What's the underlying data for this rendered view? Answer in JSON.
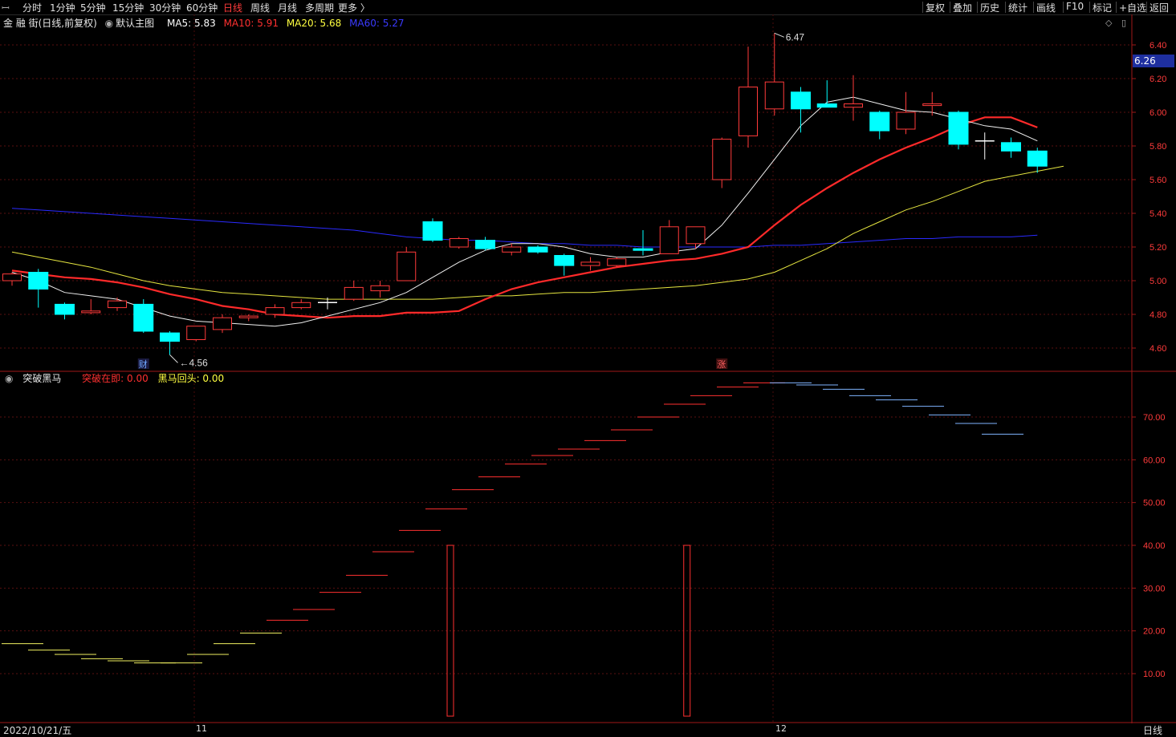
{
  "toolbar": {
    "left_icon": "ꟷ",
    "tabs": [
      {
        "label": "分时",
        "active": false
      },
      {
        "label": "1分钟",
        "active": false
      },
      {
        "label": "5分钟",
        "active": false
      },
      {
        "label": "15分钟",
        "active": false
      },
      {
        "label": "30分钟",
        "active": false
      },
      {
        "label": "60分钟",
        "active": false
      },
      {
        "label": "日线",
        "active": true
      },
      {
        "label": "周线",
        "active": false
      },
      {
        "label": "月线",
        "active": false
      },
      {
        "label": "多周期",
        "active": false
      },
      {
        "label": "更多 〉",
        "active": false
      }
    ],
    "right_buttons": [
      "复权",
      "叠加",
      "历史",
      "统计",
      "画线",
      "F10",
      "标记",
      "+自选",
      "返回"
    ]
  },
  "info": {
    "stock": "金 融 街(日线,前复权)",
    "main_chart": "默认主图",
    "ma5": "MA5: 5.83",
    "ma10": "MA10: 5.91",
    "ma20": "MA20: 5.68",
    "ma60": "MA60: 5.27",
    "ma5_color": "#ffffff",
    "ma10_color": "#ff3030",
    "ma20_color": "#ffff40",
    "ma60_color": "#3030ff"
  },
  "indicator": {
    "name": "突破黑马",
    "breakout": "突破在即: 0.00",
    "pullback": "黑马回头: 0.00"
  },
  "price_axis": [
    "6.40",
    "6.20",
    "6.00",
    "5.80",
    "5.60",
    "5.40",
    "5.20",
    "5.00",
    "4.80",
    "4.60"
  ],
  "current_price": "6.26",
  "high_label": "6.47",
  "low_label": "4.56",
  "markers": {
    "cai": "财",
    "zhang": "涨"
  },
  "sub_axis": [
    "70.00",
    "60.00",
    "50.00",
    "40.00",
    "30.00",
    "20.00",
    "10.00"
  ],
  "bottom": {
    "date": "2022/10/21/五",
    "m11": "11",
    "m12": "12",
    "period": "日线"
  },
  "chart_data": [
    {
      "type": "candlestick",
      "title": "金融街(日线,前复权)",
      "ylim": [
        4.5,
        6.5
      ],
      "candles": [
        {
          "o": 5.0,
          "h": 5.05,
          "l": 4.97,
          "c": 5.04
        },
        {
          "o": 5.05,
          "h": 5.07,
          "l": 4.84,
          "c": 4.95
        },
        {
          "o": 4.86,
          "h": 4.87,
          "l": 4.77,
          "c": 4.8
        },
        {
          "o": 4.81,
          "h": 4.89,
          "l": 4.8,
          "c": 4.82
        },
        {
          "o": 4.84,
          "h": 4.9,
          "l": 4.82,
          "c": 4.88
        },
        {
          "o": 4.86,
          "h": 4.89,
          "l": 4.69,
          "c": 4.7
        },
        {
          "o": 4.69,
          "h": 4.7,
          "l": 4.56,
          "c": 4.64
        },
        {
          "o": 4.65,
          "h": 4.73,
          "l": 4.64,
          "c": 4.73
        },
        {
          "o": 4.71,
          "h": 4.8,
          "l": 4.69,
          "c": 4.78
        },
        {
          "o": 4.78,
          "h": 4.8,
          "l": 4.76,
          "c": 4.79
        },
        {
          "o": 4.8,
          "h": 4.86,
          "l": 4.78,
          "c": 4.84
        },
        {
          "o": 4.84,
          "h": 4.89,
          "l": 4.83,
          "c": 4.87
        },
        {
          "o": 4.87,
          "h": 4.9,
          "l": 4.83,
          "c": 4.87
        },
        {
          "o": 4.89,
          "h": 5.0,
          "l": 4.88,
          "c": 4.96
        },
        {
          "o": 4.94,
          "h": 5.0,
          "l": 4.9,
          "c": 4.97
        },
        {
          "o": 5.0,
          "h": 5.2,
          "l": 5.0,
          "c": 5.17
        },
        {
          "o": 5.35,
          "h": 5.37,
          "l": 5.23,
          "c": 5.24
        },
        {
          "o": 5.2,
          "h": 5.26,
          "l": 5.19,
          "c": 5.25
        },
        {
          "o": 5.24,
          "h": 5.26,
          "l": 5.18,
          "c": 5.19
        },
        {
          "o": 5.17,
          "h": 5.22,
          "l": 5.15,
          "c": 5.2
        },
        {
          "o": 5.2,
          "h": 5.21,
          "l": 5.16,
          "c": 5.17
        },
        {
          "o": 5.15,
          "h": 5.16,
          "l": 5.03,
          "c": 5.09
        },
        {
          "o": 5.09,
          "h": 5.14,
          "l": 5.06,
          "c": 5.11
        },
        {
          "o": 5.09,
          "h": 5.14,
          "l": 5.08,
          "c": 5.13
        },
        {
          "o": 5.19,
          "h": 5.3,
          "l": 5.15,
          "c": 5.18
        },
        {
          "o": 5.16,
          "h": 5.36,
          "l": 5.16,
          "c": 5.32
        },
        {
          "o": 5.22,
          "h": 5.32,
          "l": 5.19,
          "c": 5.32
        },
        {
          "o": 5.6,
          "h": 5.85,
          "l": 5.55,
          "c": 5.84
        },
        {
          "o": 5.86,
          "h": 6.39,
          "l": 5.79,
          "c": 6.15
        },
        {
          "o": 6.02,
          "h": 6.47,
          "l": 5.98,
          "c": 6.18
        },
        {
          "o": 6.12,
          "h": 6.15,
          "l": 5.88,
          "c": 6.02
        },
        {
          "o": 6.05,
          "h": 6.19,
          "l": 6.03,
          "c": 6.03
        },
        {
          "o": 6.03,
          "h": 6.22,
          "l": 5.95,
          "c": 6.05
        },
        {
          "o": 6.0,
          "h": 6.01,
          "l": 5.84,
          "c": 5.89
        },
        {
          "o": 5.9,
          "h": 6.12,
          "l": 5.87,
          "c": 6.0
        },
        {
          "o": 6.04,
          "h": 6.12,
          "l": 5.98,
          "c": 6.05
        },
        {
          "o": 6.0,
          "h": 6.01,
          "l": 5.78,
          "c": 5.81
        },
        {
          "o": 5.83,
          "h": 5.88,
          "l": 5.72,
          "c": 5.83
        },
        {
          "o": 5.82,
          "h": 5.85,
          "l": 5.73,
          "c": 5.77
        },
        {
          "o": 5.77,
          "h": 5.79,
          "l": 5.64,
          "c": 5.68
        }
      ],
      "ma5": [
        5.05,
        5.0,
        4.93,
        4.91,
        4.89,
        4.84,
        4.79,
        4.76,
        4.75,
        4.74,
        4.73,
        4.75,
        4.79,
        4.83,
        4.87,
        4.93,
        5.02,
        5.11,
        5.18,
        5.22,
        5.22,
        5.2,
        5.16,
        5.14,
        5.14,
        5.17,
        5.19,
        5.33,
        5.52,
        5.72,
        5.92,
        6.06,
        6.09,
        6.05,
        6.01,
        6.0,
        5.96,
        5.92,
        5.9,
        5.83
      ],
      "ma10": [
        5.06,
        5.04,
        5.02,
        5.01,
        4.99,
        4.96,
        4.92,
        4.89,
        4.85,
        4.83,
        4.8,
        4.79,
        4.78,
        4.79,
        4.79,
        4.81,
        4.81,
        4.82,
        4.89,
        4.95,
        4.99,
        5.02,
        5.05,
        5.08,
        5.1,
        5.12,
        5.13,
        5.16,
        5.2,
        5.33,
        5.45,
        5.55,
        5.64,
        5.72,
        5.79,
        5.85,
        5.92,
        5.97,
        5.97,
        5.91
      ],
      "ma20": [
        5.17,
        5.14,
        5.11,
        5.08,
        5.04,
        5.0,
        4.97,
        4.95,
        4.93,
        4.92,
        4.91,
        4.9,
        4.89,
        4.89,
        4.89,
        4.89,
        4.89,
        4.9,
        4.91,
        4.91,
        4.92,
        4.93,
        4.93,
        4.94,
        4.95,
        4.96,
        4.97,
        4.99,
        5.01,
        5.05,
        5.12,
        5.19,
        5.28,
        5.35,
        5.42,
        5.47,
        5.53,
        5.59,
        5.62,
        5.65,
        5.68
      ],
      "ma60": [
        5.43,
        5.42,
        5.41,
        5.4,
        5.39,
        5.38,
        5.37,
        5.36,
        5.35,
        5.34,
        5.33,
        5.32,
        5.31,
        5.3,
        5.28,
        5.26,
        5.25,
        5.24,
        5.24,
        5.23,
        5.22,
        5.22,
        5.21,
        5.21,
        5.2,
        5.2,
        5.2,
        5.2,
        5.2,
        5.21,
        5.21,
        5.22,
        5.23,
        5.24,
        5.25,
        5.25,
        5.26,
        5.26,
        5.26,
        5.27
      ],
      "high": 6.47,
      "low": 4.56,
      "current": 6.26
    },
    {
      "type": "bar",
      "title": "突破黑马",
      "ylim": [
        0,
        80
      ],
      "series": [
        {
          "name": "突破在即",
          "values": [
            0,
            0,
            0,
            0,
            0,
            0,
            0,
            0,
            0,
            0,
            0,
            0,
            0,
            0,
            0,
            0,
            40,
            0,
            0,
            0,
            0,
            0,
            0,
            0,
            0,
            40,
            0,
            0,
            0,
            0,
            0,
            0,
            0,
            0,
            0,
            0,
            0,
            0,
            0,
            0
          ]
        },
        {
          "name": "黑马回头",
          "values": [
            0,
            0,
            0,
            0,
            0,
            0,
            0,
            0,
            0,
            0,
            0,
            0,
            0,
            0,
            0,
            0,
            0,
            0,
            0,
            0,
            0,
            0,
            0,
            0,
            0,
            0,
            0,
            0,
            0,
            0,
            0,
            0,
            0,
            0,
            0,
            0,
            0,
            0,
            0,
            0
          ]
        }
      ],
      "steps": [
        {
          "v": 17,
          "c": "y"
        },
        {
          "v": 15.5,
          "c": "y"
        },
        {
          "v": 14.5,
          "c": "y"
        },
        {
          "v": 13.5,
          "c": "y"
        },
        {
          "v": 13,
          "c": "y"
        },
        {
          "v": 12.5,
          "c": "y"
        },
        {
          "v": 12.5,
          "c": "y"
        },
        {
          "v": 14.5,
          "c": "y"
        },
        {
          "v": 17,
          "c": "y"
        },
        {
          "v": 19.5,
          "c": "y"
        },
        {
          "v": 22.5,
          "c": "r"
        },
        {
          "v": 25,
          "c": "r"
        },
        {
          "v": 29,
          "c": "r"
        },
        {
          "v": 33,
          "c": "r"
        },
        {
          "v": 38.5,
          "c": "r"
        },
        {
          "v": 43.5,
          "c": "r"
        },
        {
          "v": 48.5,
          "c": "r"
        },
        {
          "v": 53,
          "c": "r"
        },
        {
          "v": 56,
          "c": "r"
        },
        {
          "v": 59,
          "c": "r"
        },
        {
          "v": 61,
          "c": "r"
        },
        {
          "v": 62.5,
          "c": "r"
        },
        {
          "v": 64.5,
          "c": "r"
        },
        {
          "v": 67,
          "c": "r"
        },
        {
          "v": 70,
          "c": "r"
        },
        {
          "v": 73,
          "c": "r"
        },
        {
          "v": 75,
          "c": "r"
        },
        {
          "v": 77,
          "c": "r"
        },
        {
          "v": 78,
          "c": "r"
        },
        {
          "v": 78,
          "c": "b"
        },
        {
          "v": 77.5,
          "c": "b"
        },
        {
          "v": 76.5,
          "c": "b"
        },
        {
          "v": 75,
          "c": "b"
        },
        {
          "v": 74,
          "c": "b"
        },
        {
          "v": 72.5,
          "c": "b"
        },
        {
          "v": 70.5,
          "c": "b"
        },
        {
          "v": 68.5,
          "c": "b"
        },
        {
          "v": 66,
          "c": "b"
        }
      ]
    }
  ]
}
